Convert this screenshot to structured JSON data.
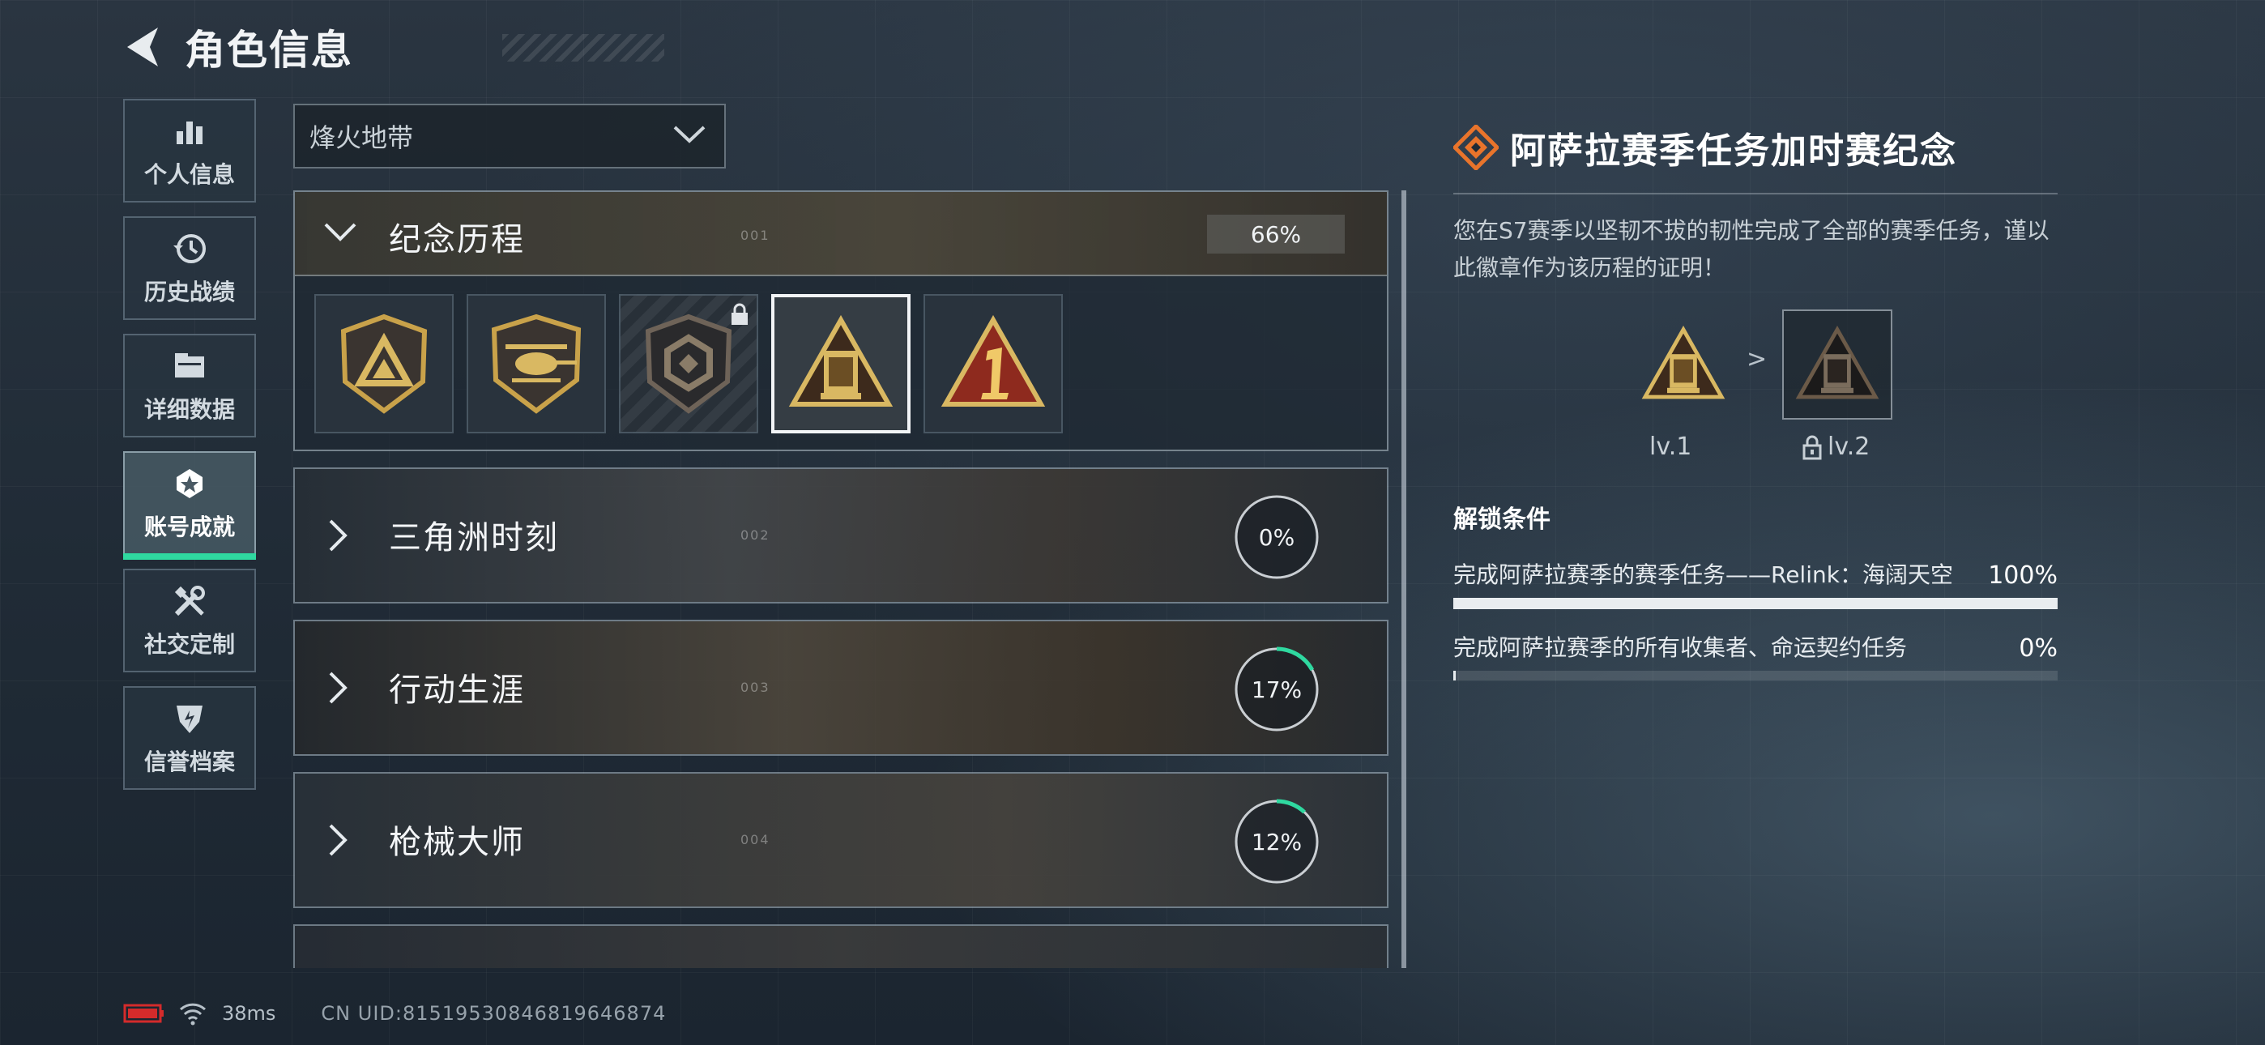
{
  "header": {
    "title": "角色信息"
  },
  "sidebar": {
    "items": [
      {
        "label": "个人信息",
        "icon": "bar-chart-icon",
        "active": false
      },
      {
        "label": "历史战绩",
        "icon": "history-icon",
        "active": false
      },
      {
        "label": "详细数据",
        "icon": "folder-icon",
        "active": false
      },
      {
        "label": "账号成就",
        "icon": "achievement-icon",
        "active": true
      },
      {
        "label": "社交定制",
        "icon": "tools-icon",
        "active": false
      },
      {
        "label": "信誉档案",
        "icon": "shield-icon",
        "active": false
      }
    ],
    "accent_color": "#2fd9a0"
  },
  "mode_select": {
    "value": "烽火地带"
  },
  "categories": [
    {
      "name": "纪念历程",
      "index": "001",
      "progress_text": "66%",
      "progress": 0.66,
      "expanded": true
    },
    {
      "name": "三角洲时刻",
      "index": "002",
      "progress_text": "0%",
      "progress": 0.0,
      "expanded": false
    },
    {
      "name": "行动生涯",
      "index": "003",
      "progress_text": "17%",
      "progress": 0.17,
      "expanded": false
    },
    {
      "name": "枪械大师",
      "index": "004",
      "progress_text": "12%",
      "progress": 0.12,
      "expanded": false
    }
  ],
  "badges": [
    {
      "name": "triangle-shield-badge",
      "locked": false,
      "selected": false
    },
    {
      "name": "helicopter-badge",
      "locked": false,
      "selected": false
    },
    {
      "name": "hexagon-badge",
      "locked": true,
      "selected": false
    },
    {
      "name": "s7-triangle-badge",
      "locked": false,
      "selected": true
    },
    {
      "name": "number-one-badge",
      "locked": false,
      "selected": false
    }
  ],
  "detail": {
    "title": "阿萨拉赛季任务加时赛纪念",
    "description": "您在S7赛季以坚韧不拔的韧性完成了全部的赛季任务，谨以此徽章作为该历程的证明！",
    "level1": "lv.1",
    "level2": "lv.2",
    "level_separator": ">",
    "conditions_title": "解锁条件",
    "conditions": [
      {
        "text": "完成阿萨拉赛季的赛季任务——Relink：海阔天空",
        "progress_text": "100%",
        "progress": 1.0
      },
      {
        "text": "完成阿萨拉赛季的所有收集者、命运契约任务",
        "progress_text": "0%",
        "progress": 0.0
      }
    ],
    "accent_color": "#e9742b"
  },
  "status_bar": {
    "ping": "38ms",
    "uid": "CN UID:8151953084681964687​4"
  },
  "colors": {
    "progress_ring": "#2fd9a0",
    "gold": "#c9a24a",
    "battery": "#d42b2b"
  }
}
